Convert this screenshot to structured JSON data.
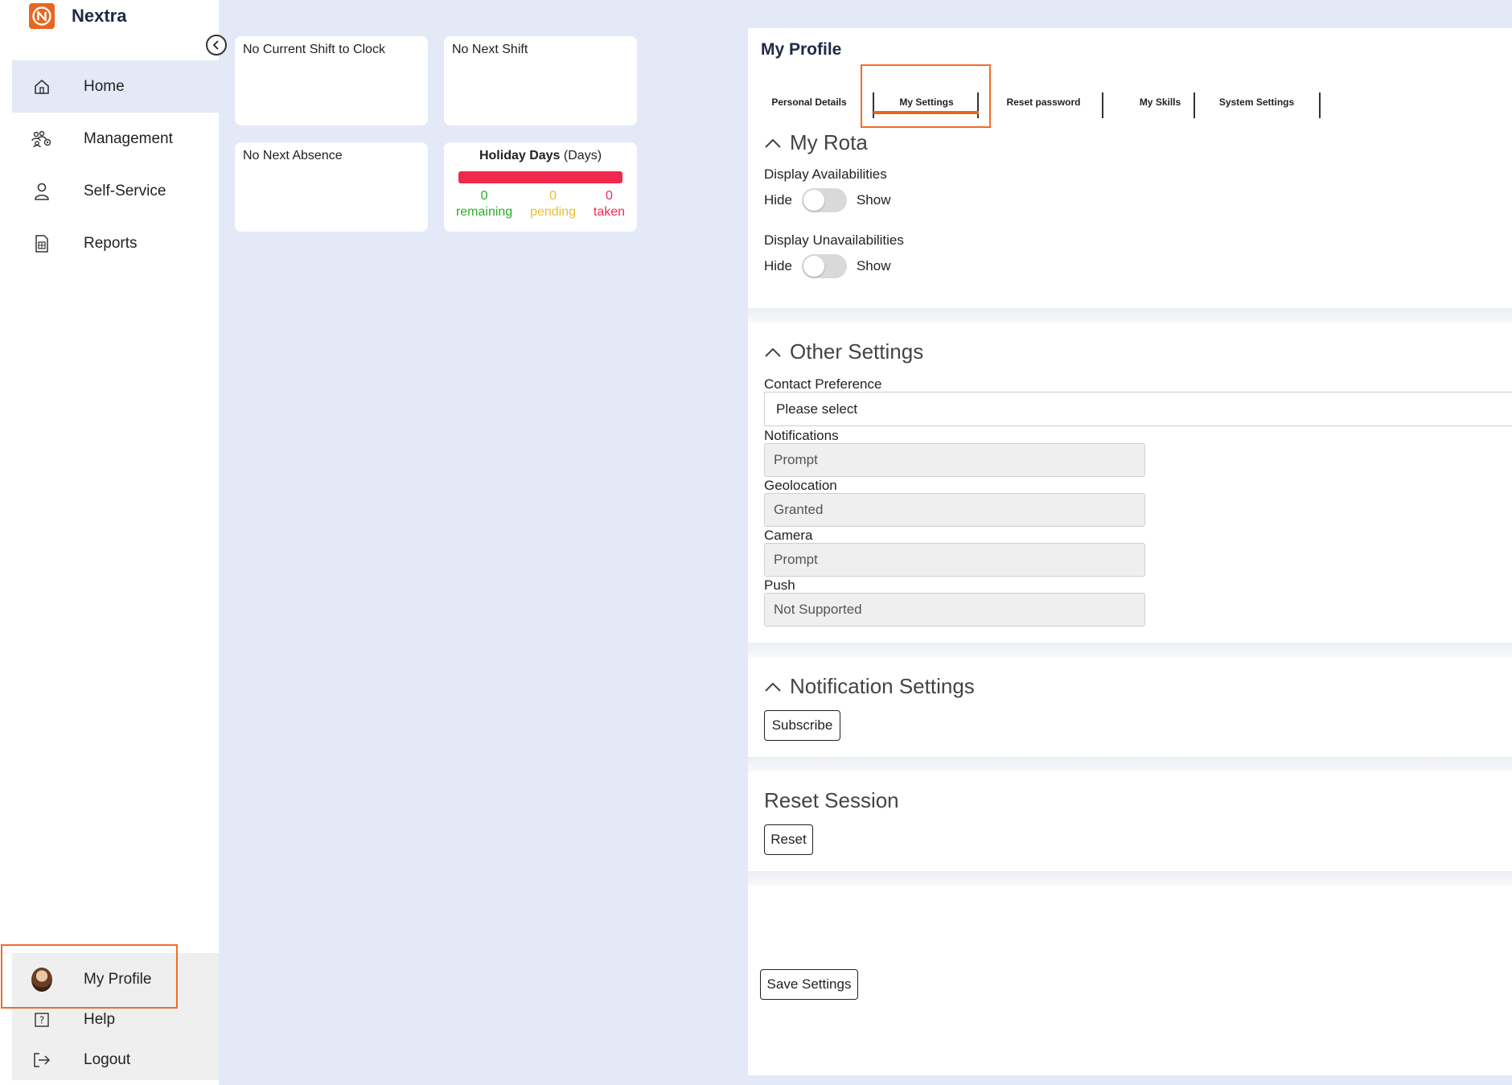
{
  "app": {
    "name": "Nextra"
  },
  "colors": {
    "brand": "#e9661e",
    "accent_bg": "#e3e9f7",
    "remaining": "#26b026",
    "pending": "#e8c12a",
    "taken": "#f0294e"
  },
  "sidebar": {
    "items": [
      {
        "label": "Home",
        "icon": "home-icon",
        "active": true
      },
      {
        "label": "Management",
        "icon": "users-icon"
      },
      {
        "label": "Self-Service",
        "icon": "person-icon"
      },
      {
        "label": "Reports",
        "icon": "report-icon"
      }
    ],
    "bottom": [
      {
        "label": "My Profile",
        "icon": "avatar"
      },
      {
        "label": "Help",
        "icon": "help-icon"
      },
      {
        "label": "Logout",
        "icon": "logout-icon"
      }
    ]
  },
  "cards": {
    "shift_clock": "No Current Shift to Clock",
    "next_shift": "No Next Shift",
    "next_absence": "No Next Absence",
    "holiday": {
      "title": "Holiday Days",
      "unit": "(Days)",
      "remaining_value": "0",
      "remaining_label": "remaining",
      "pending_value": "0",
      "pending_label": "pending",
      "taken_value": "0",
      "taken_label": "taken"
    }
  },
  "profile": {
    "title": "My Profile",
    "tabs": [
      "Personal Details",
      "My Settings",
      "Reset password",
      "My Skills",
      "System Settings"
    ],
    "active_tab": "My Settings",
    "my_rota": {
      "heading": "My Rota",
      "availabilities_label": "Display Availabilities",
      "unavailabilities_label": "Display Unavailabilities",
      "hide": "Hide",
      "show": "Show"
    },
    "other_settings": {
      "heading": "Other Settings",
      "contact_label": "Contact Preference",
      "contact_value": "Please select",
      "notifications_label": "Notifications",
      "notifications_value": "Prompt",
      "geolocation_label": "Geolocation",
      "geolocation_value": "Granted",
      "camera_label": "Camera",
      "camera_value": "Prompt",
      "push_label": "Push",
      "push_value": "Not Supported"
    },
    "notification_settings": {
      "heading": "Notification Settings",
      "subscribe": "Subscribe"
    },
    "reset_session": {
      "heading": "Reset Session",
      "reset": "Reset"
    },
    "save": "Save Settings"
  }
}
